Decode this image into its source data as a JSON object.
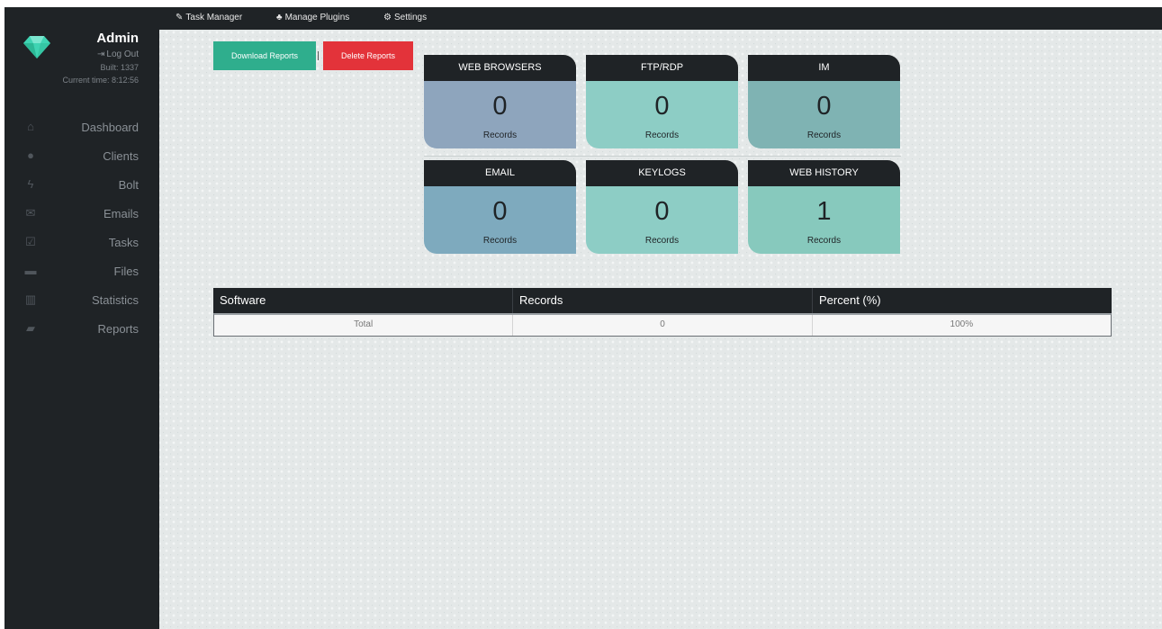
{
  "colors": {
    "sidebar_bg": "#1f2326",
    "download_btn": "#2fae8d",
    "delete_btn": "#e3333a",
    "card_web_browsers": "#8ea5bd",
    "card_ftp_rdp": "#8dcdc5",
    "card_im": "#7fb3b3",
    "card_email": "#7eaabe",
    "card_keylogs": "#8dcdc5",
    "card_web_history": "#87c9bd",
    "brand_gem": "#3fd4b3"
  },
  "sidebar": {
    "brand_icon": "diamond-icon",
    "admin_name": "Admin",
    "logout_label": "Log Out",
    "built": "Built: 1337",
    "current_time": "Current time: 8:12:56",
    "items": [
      {
        "label": "Dashboard",
        "icon": "home-icon",
        "glyph": "⌂"
      },
      {
        "label": "Clients",
        "icon": "user-icon",
        "glyph": "●"
      },
      {
        "label": "Bolt",
        "icon": "bolt-icon",
        "glyph": "ϟ"
      },
      {
        "label": "Emails",
        "icon": "envelope-icon",
        "glyph": "✉"
      },
      {
        "label": "Tasks",
        "icon": "checkbox-icon",
        "glyph": "☑"
      },
      {
        "label": "Files",
        "icon": "folder-icon",
        "glyph": "▬"
      },
      {
        "label": "Statistics",
        "icon": "bar-chart-icon",
        "glyph": "▥"
      },
      {
        "label": "Reports",
        "icon": "book-icon",
        "glyph": "▰"
      }
    ]
  },
  "topbar": {
    "items": [
      {
        "label": "Task Manager",
        "icon": "edit-icon",
        "glyph": "✎"
      },
      {
        "label": "Manage Plugins",
        "icon": "sitemap-icon",
        "glyph": "♣"
      },
      {
        "label": "Settings",
        "icon": "gears-icon",
        "glyph": "⚙"
      }
    ]
  },
  "actions": {
    "download_label": "Download Reports",
    "separator": "|",
    "delete_label": "Delete Reports"
  },
  "cards": [
    {
      "title": "WEB BROWSERS",
      "value": "0",
      "sub": "Records"
    },
    {
      "title": "FTP/RDP",
      "value": "0",
      "sub": "Records"
    },
    {
      "title": "IM",
      "value": "0",
      "sub": "Records"
    },
    {
      "title": "EMAIL",
      "value": "0",
      "sub": "Records"
    },
    {
      "title": "KEYLOGS",
      "value": "0",
      "sub": "Records"
    },
    {
      "title": "WEB HISTORY",
      "value": "1",
      "sub": "Records"
    }
  ],
  "table": {
    "headers": [
      "Software",
      "Records",
      "Percent (%)"
    ],
    "rows": [
      [
        "Total",
        "0",
        "100%"
      ]
    ]
  }
}
